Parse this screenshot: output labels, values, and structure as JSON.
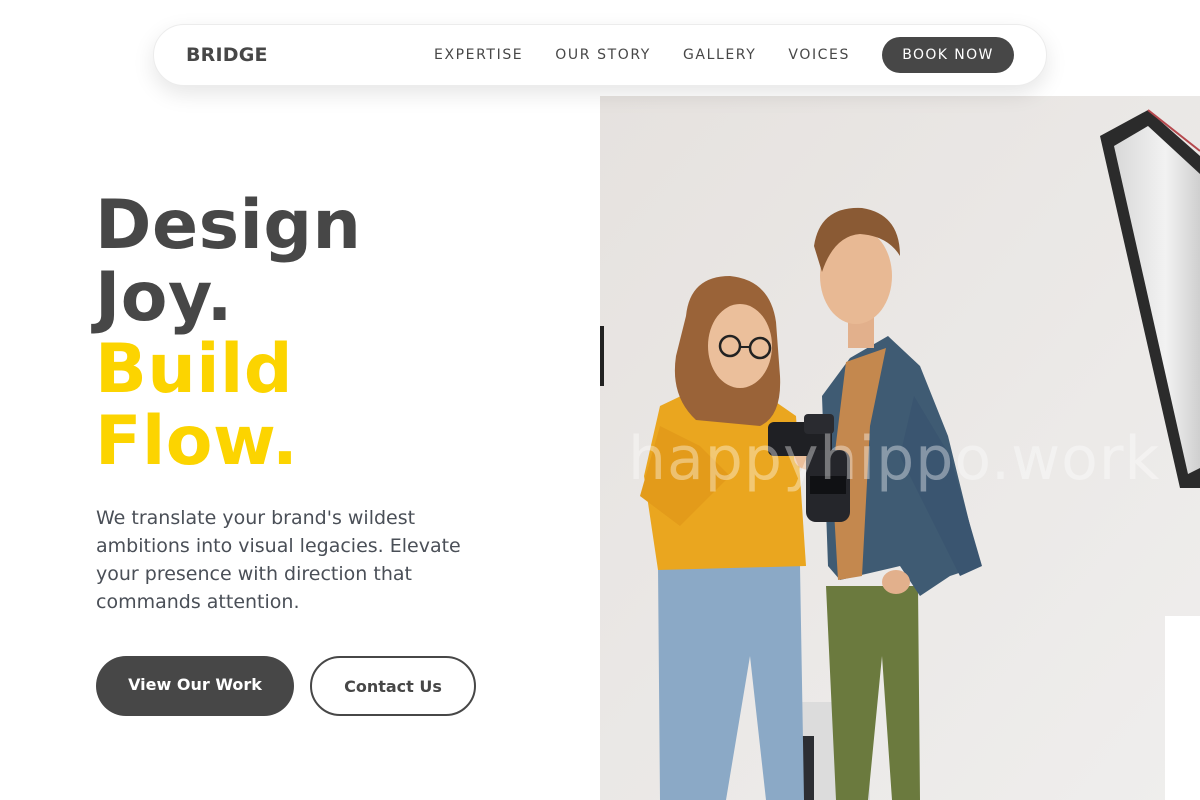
{
  "nav": {
    "brand": "BRIDGE",
    "links": [
      "EXPERTISE",
      "OUR STORY",
      "GALLERY",
      "VOICES"
    ],
    "cta": "BOOK NOW"
  },
  "hero": {
    "title_line1": "Design",
    "title_line2": "Joy.",
    "title_line3": "Build",
    "title_line4": "Flow.",
    "description": "We translate your brand's wildest ambitions into visual legacies. Elevate your presence with direction that commands attention.",
    "primary_button": "View Our Work",
    "secondary_button": "Contact Us",
    "image_watermark": "happyhippo.work"
  },
  "colors": {
    "dark": "#474747",
    "accent": "#fcd400",
    "text_muted": "#4a4f57",
    "background": "#ffffff"
  }
}
